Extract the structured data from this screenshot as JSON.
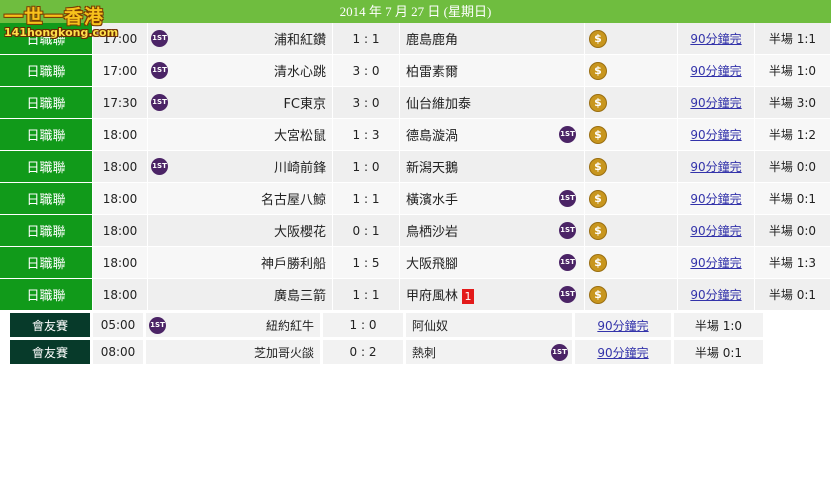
{
  "logo": {
    "title": "一世一香港",
    "domain": "141hongkong.com"
  },
  "date_header": "2014 年 7 月 27 日 (星期日)",
  "first_label": "1ST",
  "coin_symbol": "$",
  "link_label": "90分鐘完",
  "j_league_matches": [
    {
      "league": "日職聯",
      "time": "17:00",
      "home": "浦和紅鑽",
      "score": "1 : 1",
      "away": "鹿島鹿角",
      "half": "半場 1:1",
      "home_first": true,
      "away_first": false,
      "red_card": ""
    },
    {
      "league": "日職聯",
      "time": "17:00",
      "home": "清水心跳",
      "score": "3 : 0",
      "away": "柏雷素爾",
      "half": "半場 1:0",
      "home_first": true,
      "away_first": false,
      "red_card": ""
    },
    {
      "league": "日職聯",
      "time": "17:30",
      "home": "FC東京",
      "score": "3 : 0",
      "away": "仙台維加泰",
      "half": "半場 3:0",
      "home_first": true,
      "away_first": false,
      "red_card": ""
    },
    {
      "league": "日職聯",
      "time": "18:00",
      "home": "大宮松鼠",
      "score": "1 : 3",
      "away": "德島漩渦",
      "half": "半場 1:2",
      "home_first": false,
      "away_first": true,
      "red_card": ""
    },
    {
      "league": "日職聯",
      "time": "18:00",
      "home": "川崎前鋒",
      "score": "1 : 0",
      "away": "新潟天鵝",
      "half": "半場 0:0",
      "home_first": true,
      "away_first": false,
      "red_card": ""
    },
    {
      "league": "日職聯",
      "time": "18:00",
      "home": "名古屋八鯨",
      "score": "1 : 1",
      "away": "橫濱水手",
      "half": "半場 0:1",
      "home_first": false,
      "away_first": true,
      "red_card": ""
    },
    {
      "league": "日職聯",
      "time": "18:00",
      "home": "大阪櫻花",
      "score": "0 : 1",
      "away": "鳥栖沙岩",
      "half": "半場 0:0",
      "home_first": false,
      "away_first": true,
      "red_card": ""
    },
    {
      "league": "日職聯",
      "time": "18:00",
      "home": "神戶勝利船",
      "score": "1 : 5",
      "away": "大阪飛腳",
      "half": "半場 1:3",
      "home_first": false,
      "away_first": true,
      "red_card": ""
    },
    {
      "league": "日職聯",
      "time": "18:00",
      "home": "廣島三箭",
      "score": "1 : 1",
      "away": "甲府風林",
      "half": "半場 0:1",
      "home_first": false,
      "away_first": true,
      "red_card": "1"
    }
  ],
  "friendly_matches": [
    {
      "league": "會友賽",
      "time": "05:00",
      "home": "紐約紅牛",
      "score": "1 : 0",
      "away": "阿仙奴",
      "half": "半場 1:0",
      "home_first": true,
      "away_first": false
    },
    {
      "league": "會友賽",
      "time": "08:00",
      "home": "芝加哥火燄",
      "score": "0 : 2",
      "away": "熱刺",
      "half": "半場 0:1",
      "home_first": false,
      "away_first": true
    }
  ],
  "colors": {
    "header_green": "#6fbd3f",
    "league_green": "#119a1a",
    "friendly_dark": "#073a2a",
    "badge_purple": "#4b2466",
    "coin_gold": "#c8961e",
    "red_card": "#e31a1a"
  }
}
